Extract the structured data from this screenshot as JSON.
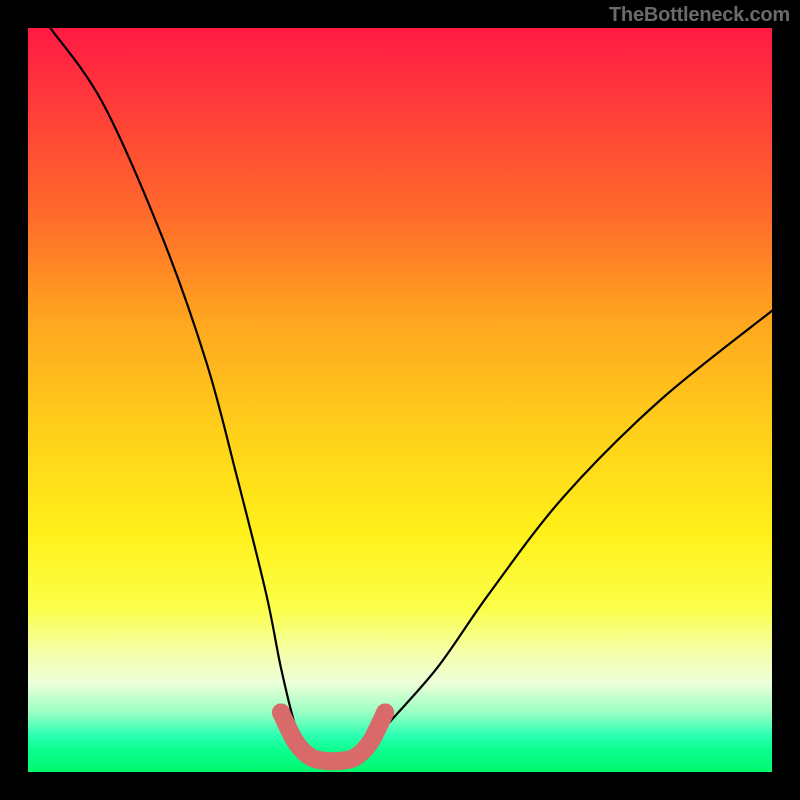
{
  "watermark": "TheBottleneck.com",
  "chart_data": {
    "type": "line",
    "title": "",
    "xlabel": "",
    "ylabel": "",
    "xlim": [
      0,
      100
    ],
    "ylim": [
      0,
      100
    ],
    "gradient_note": "vertical gradient red→orange→yellow→green (bottleneck heatmap background)",
    "series": [
      {
        "name": "bottleneck-curve",
        "color": "#000000",
        "x": [
          3,
          10,
          18,
          24,
          28,
          32,
          34,
          36,
          38,
          40,
          42,
          45,
          48,
          55,
          62,
          72,
          85,
          100
        ],
        "values": [
          100,
          90,
          72,
          55,
          40,
          24,
          14,
          6,
          2,
          1,
          1,
          2,
          6,
          14,
          24,
          37,
          50,
          62
        ]
      },
      {
        "name": "valley-markers",
        "color": "#d86a6a",
        "type": "scatter",
        "x": [
          34,
          36,
          38,
          40,
          42,
          44,
          46,
          48
        ],
        "values": [
          8,
          4,
          2,
          1.5,
          1.5,
          2,
          4,
          8
        ]
      }
    ]
  }
}
